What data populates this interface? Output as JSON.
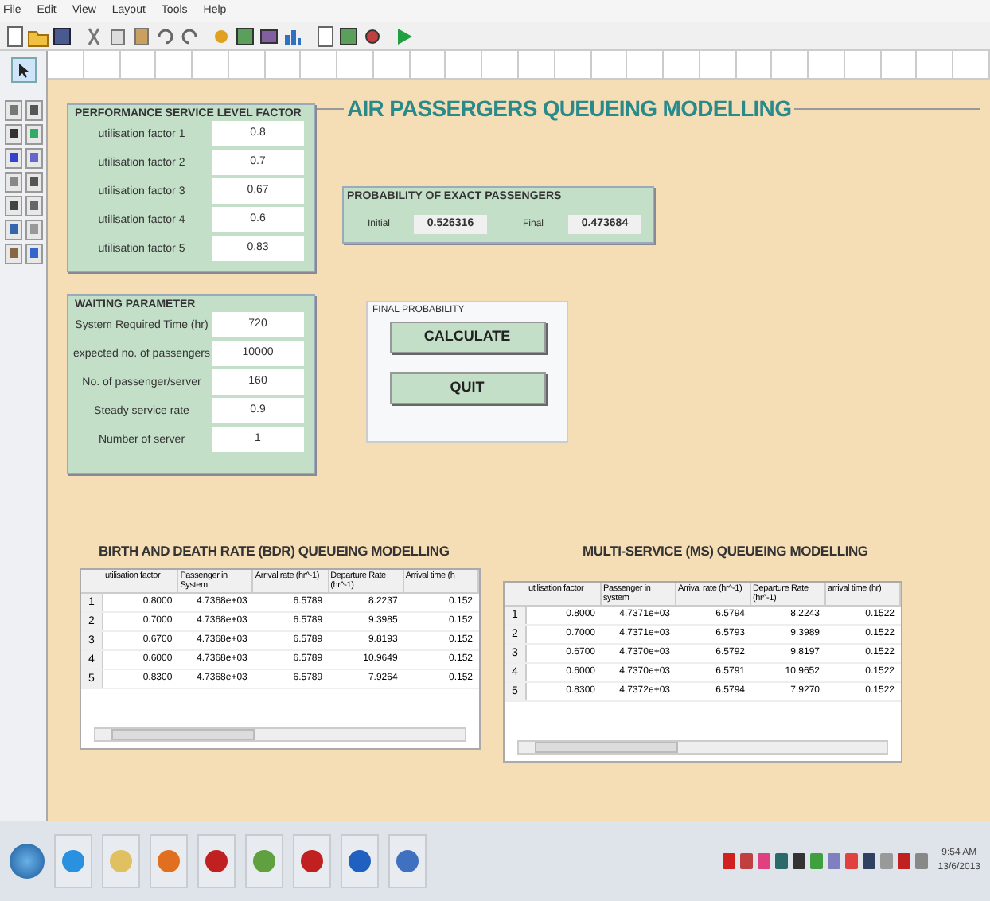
{
  "menu": [
    "File",
    "Edit",
    "View",
    "Layout",
    "Tools",
    "Help"
  ],
  "title": "AIR PASSERGERS QUEUEING MODELLING",
  "performance_panel": {
    "title": "PERFORMANCE SERVICE LEVEL FACTOR",
    "fields": [
      {
        "label": "utilisation factor 1",
        "value": "0.8"
      },
      {
        "label": "utilisation factor 2",
        "value": "0.7"
      },
      {
        "label": "utilisation factor 3",
        "value": "0.67"
      },
      {
        "label": "utilisation factor 4",
        "value": "0.6"
      },
      {
        "label": "utilisation factor 5",
        "value": "0.83"
      }
    ]
  },
  "probability_panel": {
    "title": "PROBABILITY OF EXACT PASSENGERS",
    "fields": [
      {
        "label": "Initial",
        "value": "0.526316"
      },
      {
        "label": "Final",
        "value": "0.473684"
      }
    ]
  },
  "waiting_panel": {
    "title": "WAITING PARAMETER",
    "fields": [
      {
        "label": "System Required Time (hr)",
        "value": "720"
      },
      {
        "label": "expected no. of passengers",
        "value": "10000"
      },
      {
        "label": "No. of passenger/server",
        "value": "160"
      },
      {
        "label": "Steady service rate",
        "value": "0.9"
      },
      {
        "label": "Number of server",
        "value": "1"
      }
    ]
  },
  "final_panel": {
    "title": "FINAL PROBABILITY",
    "buttons": [
      "CALCULATE",
      "QUIT"
    ]
  },
  "tables": [
    {
      "title": "BIRTH AND DEATH RATE (BDR) QUEUEING MODELLING",
      "columns": [
        "utilisation factor",
        "Passenger in System",
        "Arrival rate (hr^-1)",
        "Departure Rate (hr^-1)",
        "Arrival time (h"
      ],
      "rows": [
        {
          "index": "1",
          "cells": [
            "0.8000",
            "4.7368e+03",
            "6.5789",
            "8.2237",
            "0.152"
          ]
        },
        {
          "index": "2",
          "cells": [
            "0.7000",
            "4.7368e+03",
            "6.5789",
            "9.3985",
            "0.152"
          ]
        },
        {
          "index": "3",
          "cells": [
            "0.6700",
            "4.7368e+03",
            "6.5789",
            "9.8193",
            "0.152"
          ]
        },
        {
          "index": "4",
          "cells": [
            "0.6000",
            "4.7368e+03",
            "6.5789",
            "10.9649",
            "0.152"
          ]
        },
        {
          "index": "5",
          "cells": [
            "0.8300",
            "4.7368e+03",
            "6.5789",
            "7.9264",
            "0.152"
          ]
        }
      ]
    },
    {
      "title": "MULTI-SERVICE (MS) QUEUEING MODELLING",
      "columns": [
        "utilisation factor",
        "Passenger in system",
        "Arrival rate (hr^-1)",
        "Departure Rate (hr^-1)",
        "arrival time (hr)"
      ],
      "rows": [
        {
          "index": "1",
          "cells": [
            "0.8000",
            "4.7371e+03",
            "6.5794",
            "8.2243",
            "0.1522"
          ]
        },
        {
          "index": "2",
          "cells": [
            "0.7000",
            "4.7371e+03",
            "6.5793",
            "9.3989",
            "0.1522"
          ]
        },
        {
          "index": "3",
          "cells": [
            "0.6700",
            "4.7370e+03",
            "6.5792",
            "9.8197",
            "0.1522"
          ]
        },
        {
          "index": "4",
          "cells": [
            "0.6000",
            "4.7370e+03",
            "6.5791",
            "10.9652",
            "0.1522"
          ]
        },
        {
          "index": "5",
          "cells": [
            "0.8300",
            "4.7372e+03",
            "6.5794",
            "7.9270",
            "0.1522"
          ]
        }
      ]
    }
  ],
  "clock": {
    "time": "9:54 AM",
    "date": "13/6/2013"
  }
}
